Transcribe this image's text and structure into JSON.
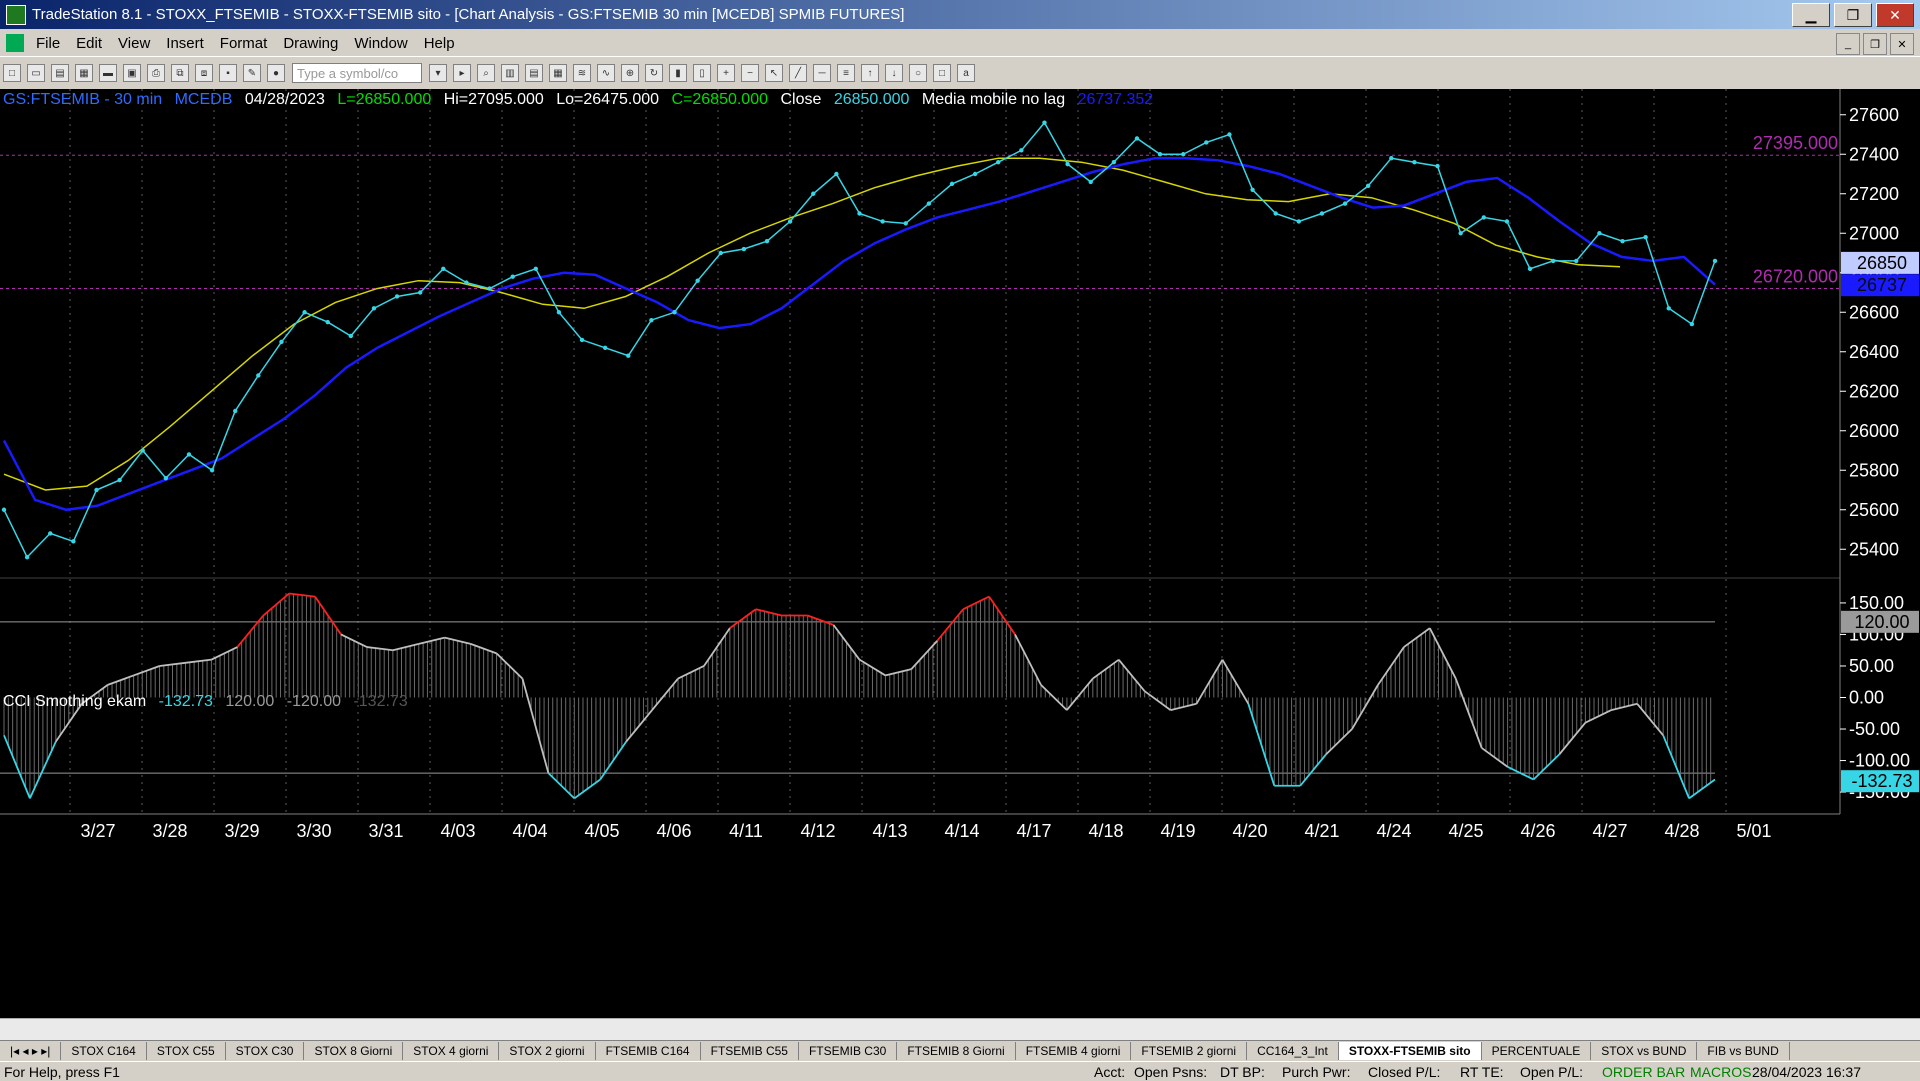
{
  "window": {
    "title": "TradeStation 8.1 - STOXX_FTSEMIB - STOXX-FTSEMIB sito - [Chart Analysis - GS:FTSEMIB  30 min  [MCEDB] SPMIB FUTURES]",
    "minimize": "▁",
    "maximize": "❐",
    "close": "✕"
  },
  "menu": [
    "File",
    "Edit",
    "View",
    "Insert",
    "Format",
    "Drawing",
    "Window",
    "Help"
  ],
  "toolbar": {
    "symbol_placeholder": "Type a symbol/co"
  },
  "chart_header": {
    "symbol": "GS:FTSEMIB - 30 min",
    "code": "MCEDB",
    "date": "04/28/2023",
    "last": "L=26850.000",
    "hi": "Hi=27095.000",
    "lo": "Lo=26475.000",
    "close_val": "C=26850.000",
    "close_label": "Close",
    "close_num": "26850.000",
    "ma_label": "Media mobile no lag",
    "ma_value": "26737.352"
  },
  "cci_header": {
    "name": "CCI Smothing ekam",
    "v1": "-132.73",
    "v2": "120.00",
    "v3": "-120.00",
    "v4": "-132.73"
  },
  "colors": {
    "price": "#37d6e6",
    "ma_blue": "#1a1aff",
    "ma_yellow": "#d6d600",
    "level": "#b02cb0",
    "cci_line": "#bfbfbf",
    "cci_over": "#ff2020",
    "cci_under": "#37d6e6"
  },
  "chart_data": [
    {
      "type": "line",
      "ylim": [
        25300,
        27700
      ],
      "y_ticks": [
        "27600",
        "27400",
        "27200",
        "27000",
        "26800",
        "26600",
        "26400",
        "26200",
        "26000",
        "25800",
        "25600",
        "25400"
      ],
      "x_labels": [
        "3/27",
        "3/28",
        "3/29",
        "3/30",
        "3/31",
        "4/03",
        "4/04",
        "4/05",
        "4/06",
        "4/11",
        "4/12",
        "4/13",
        "4/14",
        "4/17",
        "4/18",
        "4/19",
        "4/20",
        "4/21",
        "4/24",
        "4/25",
        "4/26",
        "4/27",
        "4/28",
        "5/01"
      ],
      "levels": [
        {
          "label": "27395.000",
          "value": 27395
        },
        {
          "label": "26720.000",
          "value": 26720
        }
      ],
      "price_tags": [
        {
          "label": "26850",
          "value": 26850
        },
        {
          "label": "26737",
          "value": 26737
        }
      ],
      "series": [
        {
          "values": [
            25600,
            25360,
            25480,
            25440,
            25700,
            25750,
            25900,
            25760,
            25880,
            25800,
            26100,
            26280,
            26450,
            26600,
            26550,
            26480,
            26620,
            26680,
            26700,
            26820,
            26750,
            26720,
            26780,
            26820,
            26600,
            26460,
            26420,
            26380,
            26560,
            26600,
            26760,
            26900,
            26920,
            26960,
            27060,
            27200,
            27300,
            27100,
            27060,
            27050,
            27150,
            27250,
            27300,
            27360,
            27420,
            27560,
            27350,
            27260,
            27360,
            27480,
            27400,
            27400,
            27460,
            27500,
            27220,
            27100,
            27060,
            27100,
            27150,
            27240,
            27380,
            27360,
            27340,
            27000,
            27080,
            27060,
            26820,
            26860,
            26860,
            27000,
            26960,
            26980,
            26620,
            26540,
            26860
          ]
        },
        {
          "values": [
            25950,
            25650,
            25600,
            25620,
            25680,
            25740,
            25800,
            25860,
            25960,
            26060,
            26180,
            26320,
            26420,
            26500,
            26580,
            26650,
            26720,
            26770,
            26800,
            26790,
            26720,
            26650,
            26560,
            26520,
            26540,
            26620,
            26740,
            26860,
            26950,
            27020,
            27080,
            27120,
            27160,
            27210,
            27260,
            27310,
            27350,
            27380,
            27380,
            27370,
            27340,
            27300,
            27240,
            27180,
            27130,
            27140,
            27200,
            27260,
            27280,
            27180,
            27060,
            26950,
            26880,
            26860,
            26880,
            26740
          ]
        },
        {
          "values": [
            25780,
            25700,
            25720,
            25850,
            26020,
            26200,
            26380,
            26540,
            26650,
            26720,
            26760,
            26750,
            26700,
            26640,
            26620,
            26680,
            26780,
            26900,
            27000,
            27080,
            27150,
            27230,
            27290,
            27340,
            27380,
            27380,
            27360,
            27320,
            27260,
            27200,
            27170,
            27160,
            27200,
            27180,
            27120,
            27050,
            26940,
            26880,
            26840,
            26830
          ]
        }
      ]
    },
    {
      "type": "area",
      "ylim": [
        -180,
        180
      ],
      "y_ticks": [
        "150.00",
        "100.00",
        "50.00",
        "0.00",
        "-50.00",
        "-100.00",
        "-150.00"
      ],
      "tags": [
        {
          "label": "120.00",
          "value": 120
        },
        {
          "label": "-132.73",
          "value": -132.73
        }
      ],
      "values": [
        -60,
        -160,
        -70,
        -10,
        20,
        35,
        50,
        55,
        60,
        80,
        130,
        165,
        160,
        100,
        80,
        75,
        85,
        95,
        85,
        70,
        30,
        -120,
        -160,
        -130,
        -70,
        -20,
        30,
        50,
        110,
        140,
        130,
        130,
        115,
        60,
        35,
        45,
        90,
        140,
        160,
        100,
        20,
        -20,
        30,
        60,
        10,
        -20,
        -10,
        60,
        -10,
        -140,
        -140,
        -90,
        -50,
        20,
        80,
        110,
        30,
        -80,
        -110,
        -130,
        -90,
        -40,
        -20,
        -10,
        -60,
        -160,
        -130
      ]
    }
  ],
  "tabs": [
    "STOX C164",
    "STOX C55",
    "STOX  C30",
    "STOX  8 Giorni",
    "STOX 4 giorni",
    "STOX  2 giorni",
    "FTSEMIB C164",
    "FTSEMIB C55",
    "FTSEMIB C30",
    "FTSEMIB  8 Giorni",
    "FTSEMIB  4 giorni",
    "FTSEMIB  2 giorni",
    "CC164_3_Int",
    "STOXX-FTSEMIB sito",
    "PERCENTUALE",
    "STOX vs BUND",
    "FIB vs BUND"
  ],
  "active_tab": 13,
  "status": {
    "help": "For Help, press F1",
    "acct": "Acct:",
    "open_psns": "Open Psns:",
    "dt_bp": "DT BP:",
    "purch_pwr": "Purch Pwr:",
    "closed_pl": "Closed P/L:",
    "rt_te": "RT TE:",
    "open_pl": "Open P/L:",
    "order_bar": "ORDER BAR",
    "macros": "MACROS",
    "datetime": "28/04/2023 16:37"
  }
}
